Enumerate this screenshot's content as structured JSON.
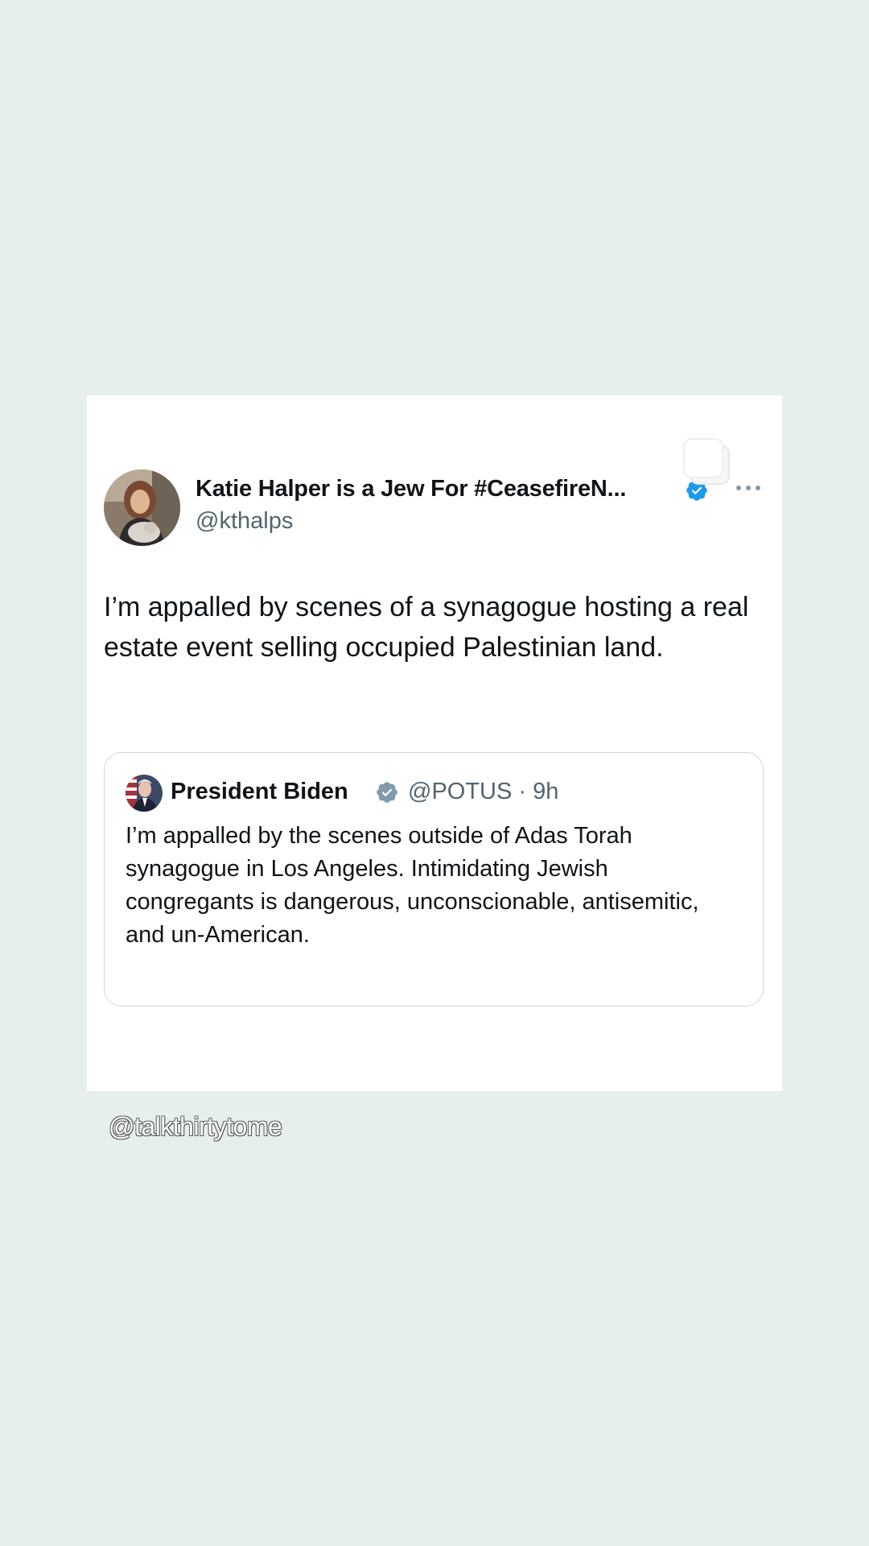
{
  "colors": {
    "background": "#e6eeee",
    "card": "#ffffff",
    "text_primary": "#0f1419",
    "text_secondary": "#536471",
    "verified_blue": "#1d9bf0",
    "verified_gray": "#829aab",
    "border": "#cfd9de"
  },
  "tweet": {
    "display_name": "Katie Halper is a Jew For #CeasefireN...",
    "handle": "@kthalps",
    "verified_icon": "verified-badge-blue",
    "more_icon": "more-options-icon",
    "copy_icon": "copy-icon",
    "text": "I’m appalled by scenes of a synagogue hosting a real estate event selling occupied Palestinian land."
  },
  "quoted_tweet": {
    "display_name": "President Biden",
    "verified_icon": "verified-badge-gray",
    "handle_time": "@POTUS · 9h",
    "text": "I’m appalled by the scenes outside of Adas Torah synagogue in Los Angeles. Intimidating Jewish congregants is dangerous, unconscionable, antisemitic, and un-American."
  },
  "watermark": "@talkthirtytome"
}
